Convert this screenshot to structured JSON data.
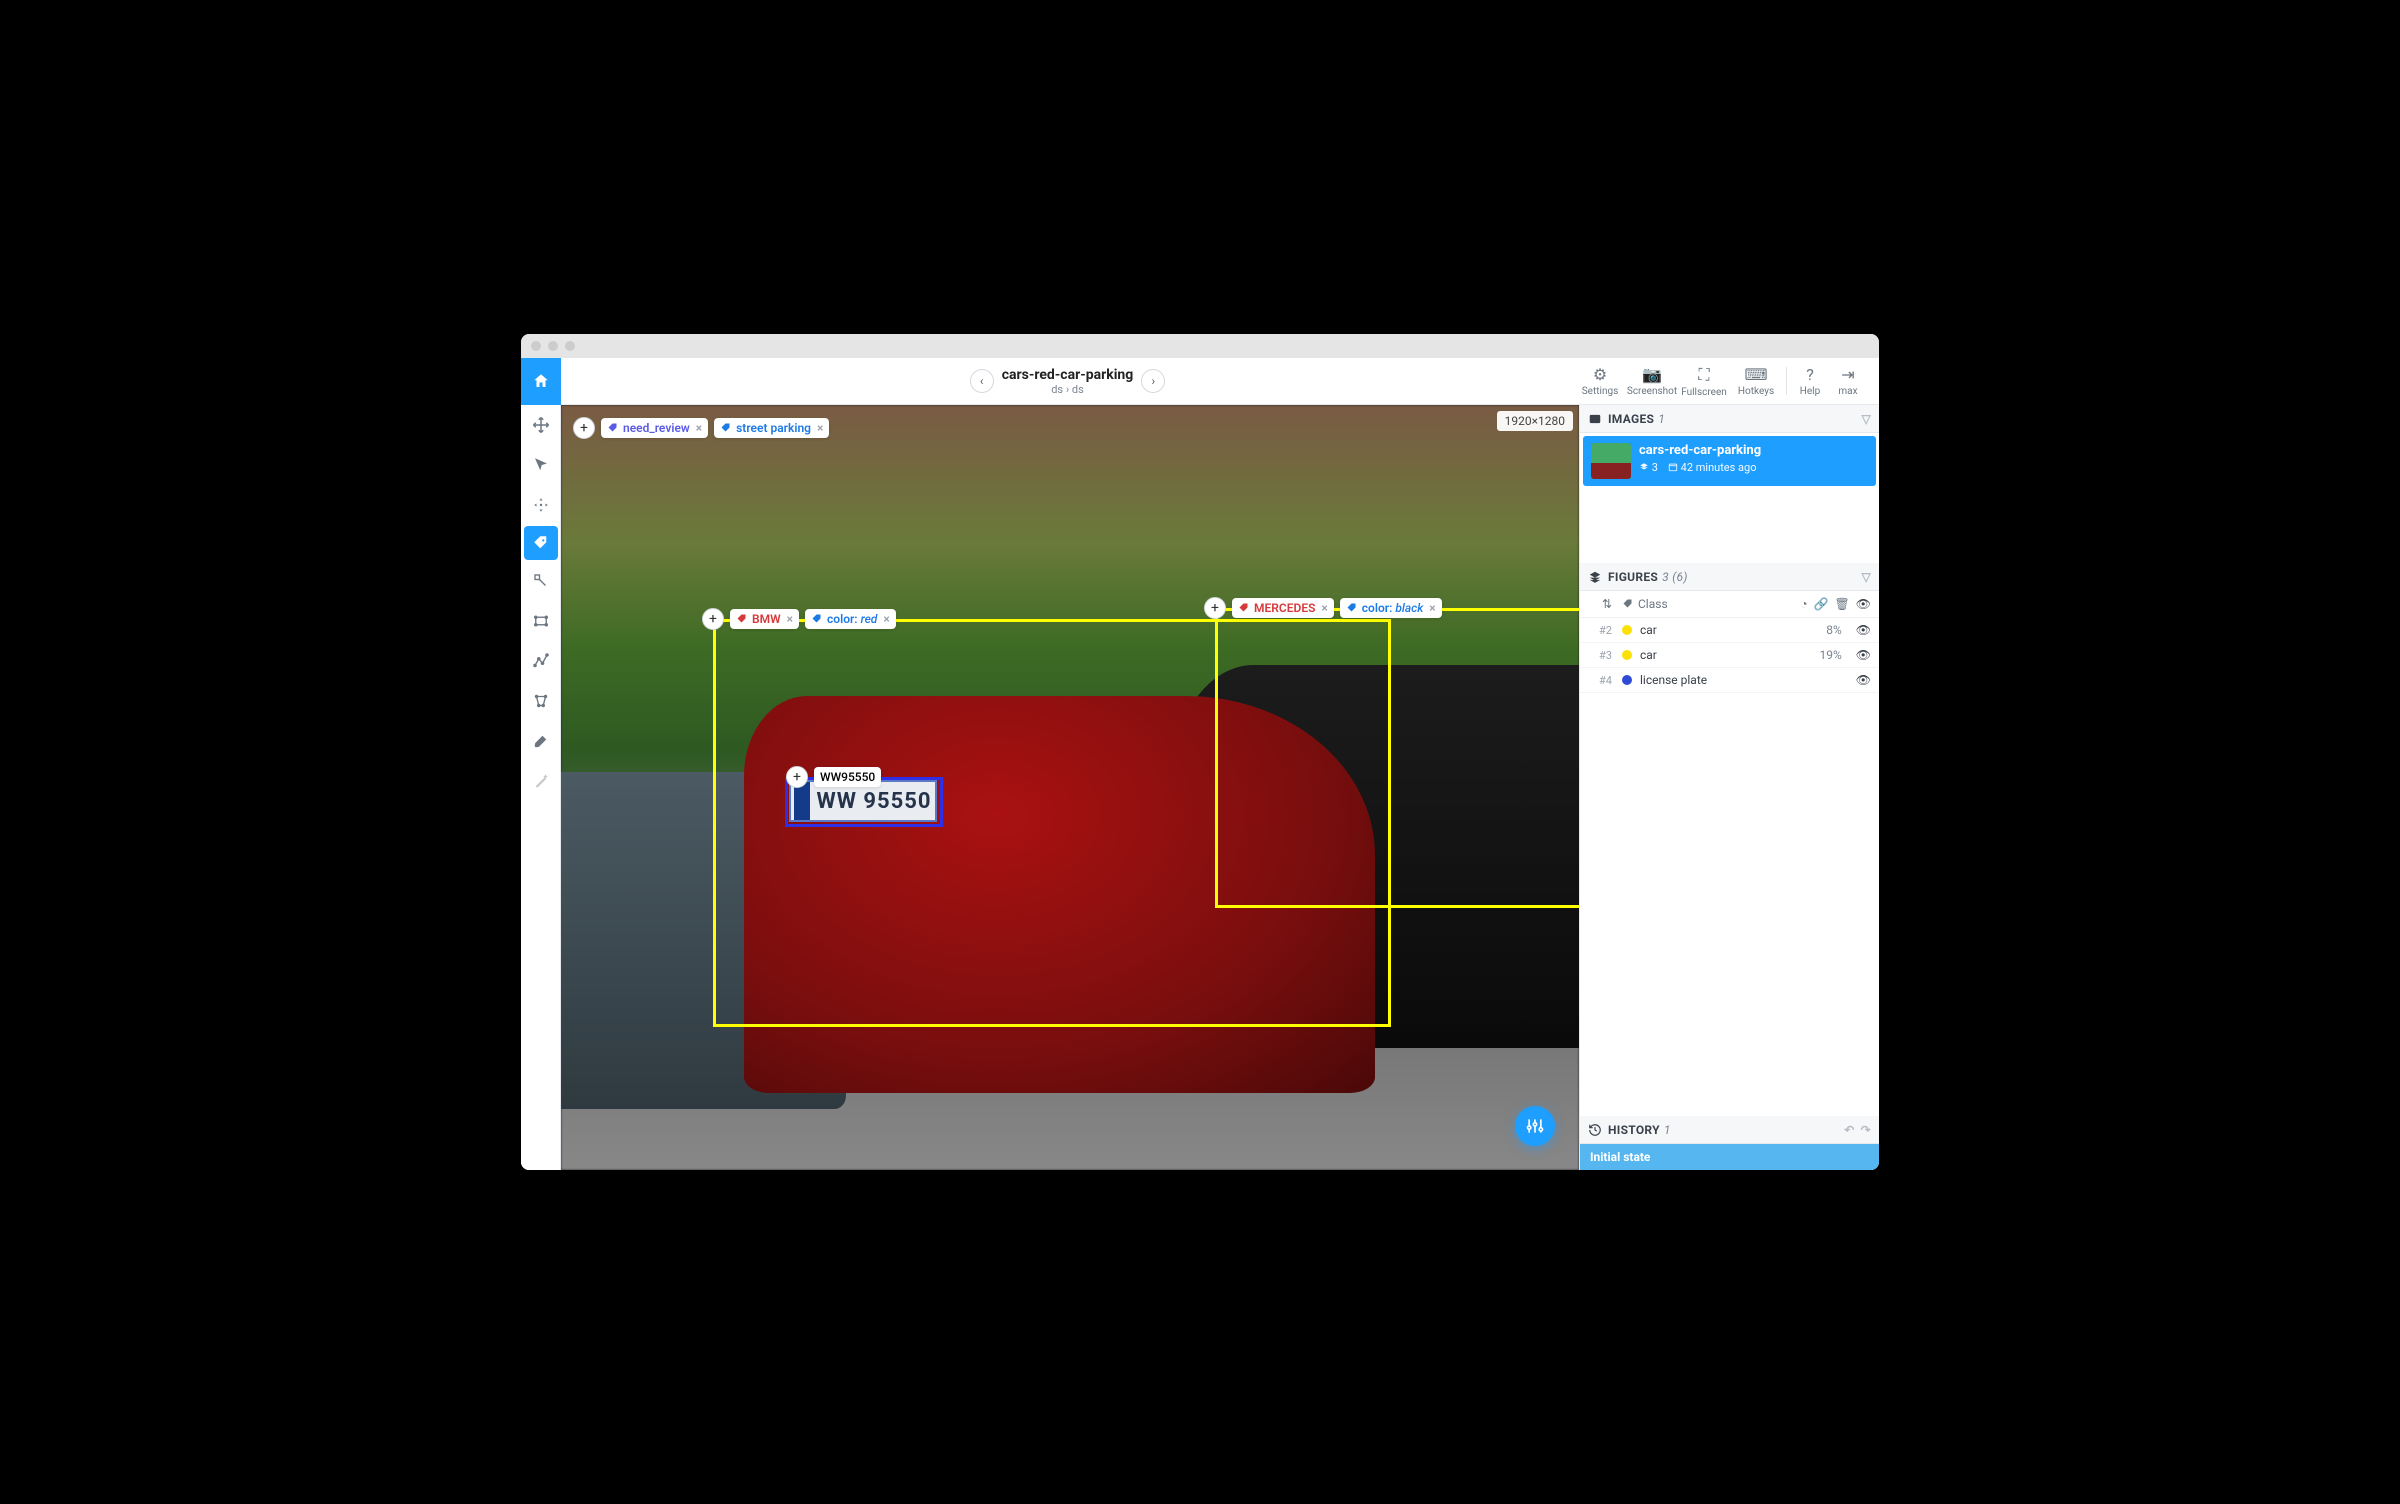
{
  "header": {
    "title": "cars-red-car-parking",
    "crumb1": "ds",
    "crumb_sep": "›",
    "crumb2": "ds",
    "actions": {
      "settings": "Settings",
      "screenshot": "Screenshot",
      "fullscreen": "Fullscreen",
      "hotkeys": "Hotkeys",
      "help": "Help",
      "user": "max"
    }
  },
  "canvas": {
    "dimensions": "1920×1280",
    "image_tags": [
      {
        "label": "need_review",
        "color": "purple"
      },
      {
        "label": "street parking",
        "color": "blue"
      }
    ],
    "annotations": {
      "bmw": {
        "name": "BMW",
        "color_label": "color:",
        "color_value": "red"
      },
      "mercedes": {
        "name": "MERCEDES",
        "color_label": "color:",
        "color_value": "black"
      },
      "plate": {
        "text_tag": "WW95550",
        "rendered": "WW 95550"
      }
    }
  },
  "panels": {
    "images": {
      "title": "IMAGES",
      "count": "1",
      "item": {
        "name": "cars-red-car-parking",
        "layers": "3",
        "time": "42 minutes ago"
      }
    },
    "figures": {
      "title": "FIGURES",
      "count_main": "3",
      "count_sub": "(6)",
      "head_class": "Class",
      "rows": [
        {
          "id": "#2",
          "dot": "#fbe106",
          "name": "car",
          "pct": "8%"
        },
        {
          "id": "#3",
          "dot": "#fbe106",
          "name": "car",
          "pct": "19%"
        },
        {
          "id": "#4",
          "dot": "#2f4bd6",
          "name": "license plate",
          "pct": ""
        }
      ]
    },
    "history": {
      "title": "HISTORY",
      "count": "1",
      "item": "Initial state"
    }
  }
}
